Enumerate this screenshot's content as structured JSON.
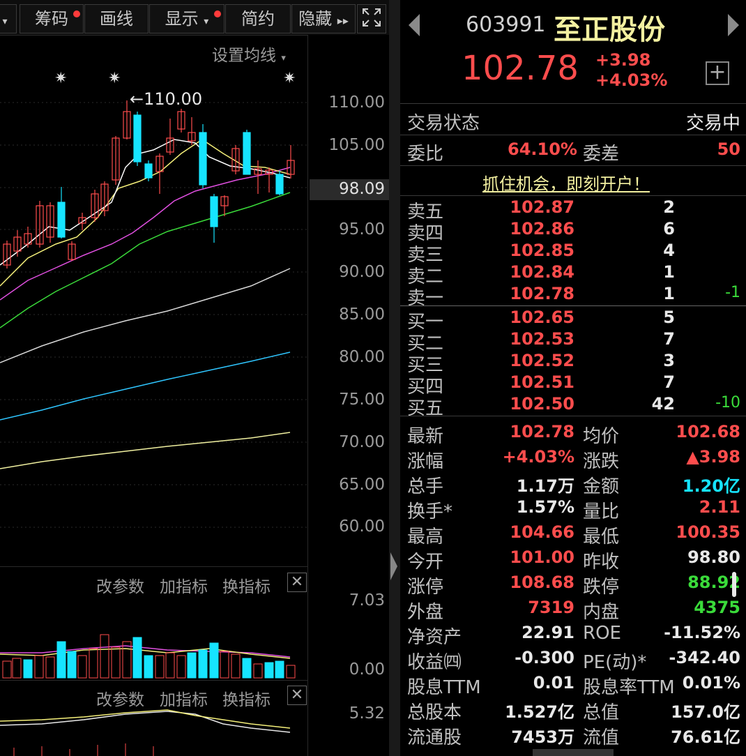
{
  "toolbar": {
    "buttons": [
      "筹码",
      "画线",
      "显示",
      "简约",
      "隐藏"
    ]
  },
  "chart": {
    "ma_setting": "设置均线",
    "price_axis": [
      "110.00",
      "105.00",
      "98.09",
      "95.00",
      "90.00",
      "85.00",
      "80.00",
      "75.00",
      "70.00",
      "65.00",
      "60.00"
    ],
    "high_marker": "110.00",
    "current_price_label": "98.09",
    "panel_links": [
      "改参数",
      "加指标",
      "换指标"
    ],
    "volume_axis": [
      "7.03",
      "0.00"
    ],
    "indicator_axis": [
      "5.32"
    ]
  },
  "stock": {
    "code": "603991",
    "name": "至正股份",
    "price": "102.78",
    "change": "+3.98",
    "change_pct": "+4.03%"
  },
  "status": {
    "label": "交易状态",
    "value": "交易中",
    "weibi_label": "委比",
    "weibi": "64.10%",
    "weicha_label": "委差",
    "weicha": "50"
  },
  "promo": "抓住机会，即刻开户！",
  "order_book": {
    "asks": [
      {
        "label": "卖五",
        "price": "102.87",
        "vol": "2",
        "delta": ""
      },
      {
        "label": "卖四",
        "price": "102.86",
        "vol": "6",
        "delta": ""
      },
      {
        "label": "卖三",
        "price": "102.85",
        "vol": "4",
        "delta": ""
      },
      {
        "label": "卖二",
        "price": "102.84",
        "vol": "1",
        "delta": ""
      },
      {
        "label": "卖一",
        "price": "102.78",
        "vol": "1",
        "delta": "-1"
      }
    ],
    "bids": [
      {
        "label": "买一",
        "price": "102.65",
        "vol": "5",
        "delta": ""
      },
      {
        "label": "买二",
        "price": "102.53",
        "vol": "7",
        "delta": ""
      },
      {
        "label": "买三",
        "price": "102.52",
        "vol": "3",
        "delta": ""
      },
      {
        "label": "买四",
        "price": "102.51",
        "vol": "7",
        "delta": ""
      },
      {
        "label": "买五",
        "price": "102.50",
        "vol": "42",
        "delta": "-10"
      }
    ]
  },
  "quote": {
    "rows": [
      {
        "l1": "最新",
        "v1": "102.78",
        "c1": "red",
        "l2": "均价",
        "v2": "102.68",
        "c2": "red"
      },
      {
        "l1": "涨幅",
        "v1": "+4.03%",
        "c1": "red",
        "l2": "涨跌",
        "v2": "▲3.98",
        "c2": "red"
      },
      {
        "l1": "总手",
        "v1": "1.17万",
        "c1": "white",
        "l2": "金额",
        "v2": "1.20亿",
        "c2": "cyan"
      },
      {
        "l1": "换手*",
        "v1": "1.57%",
        "c1": "white",
        "l2": "量比",
        "v2": "2.11",
        "c2": "red"
      },
      {
        "l1": "最高",
        "v1": "104.66",
        "c1": "red",
        "l2": "最低",
        "v2": "100.35",
        "c2": "red"
      },
      {
        "l1": "今开",
        "v1": "101.00",
        "c1": "red",
        "l2": "昨收",
        "v2": "98.80",
        "c2": "white"
      },
      {
        "l1": "涨停",
        "v1": "108.68",
        "c1": "red",
        "l2": "跌停",
        "v2": "88.92",
        "c2": "green"
      },
      {
        "l1": "外盘",
        "v1": "7319",
        "c1": "red",
        "l2": "内盘",
        "v2": "4375",
        "c2": "green"
      },
      {
        "l1": "净资产",
        "v1": "22.91",
        "c1": "white",
        "l2": "ROE",
        "v2": "-11.52%",
        "c2": "white"
      },
      {
        "l1": "收益㈣",
        "v1": "-0.300",
        "c1": "white",
        "l2": "PE(动)*",
        "v2": "-342.40",
        "c2": "white"
      },
      {
        "l1": "股息TTM",
        "v1": "0.01",
        "c1": "white",
        "l2": "股息率TTM",
        "v2": "0.01%",
        "c2": "white"
      },
      {
        "l1": "总股本",
        "v1": "1.527亿",
        "c1": "white",
        "l2": "总值",
        "v2": "157.0亿",
        "c2": "white"
      },
      {
        "l1": "流通股",
        "v1": "7453万",
        "c1": "white",
        "l2": "流值",
        "v2": "76.61亿",
        "c2": "white"
      }
    ]
  },
  "colors": {
    "up": "#ff4d4d",
    "down": "#16e4ff",
    "green": "#3adb3a"
  }
}
